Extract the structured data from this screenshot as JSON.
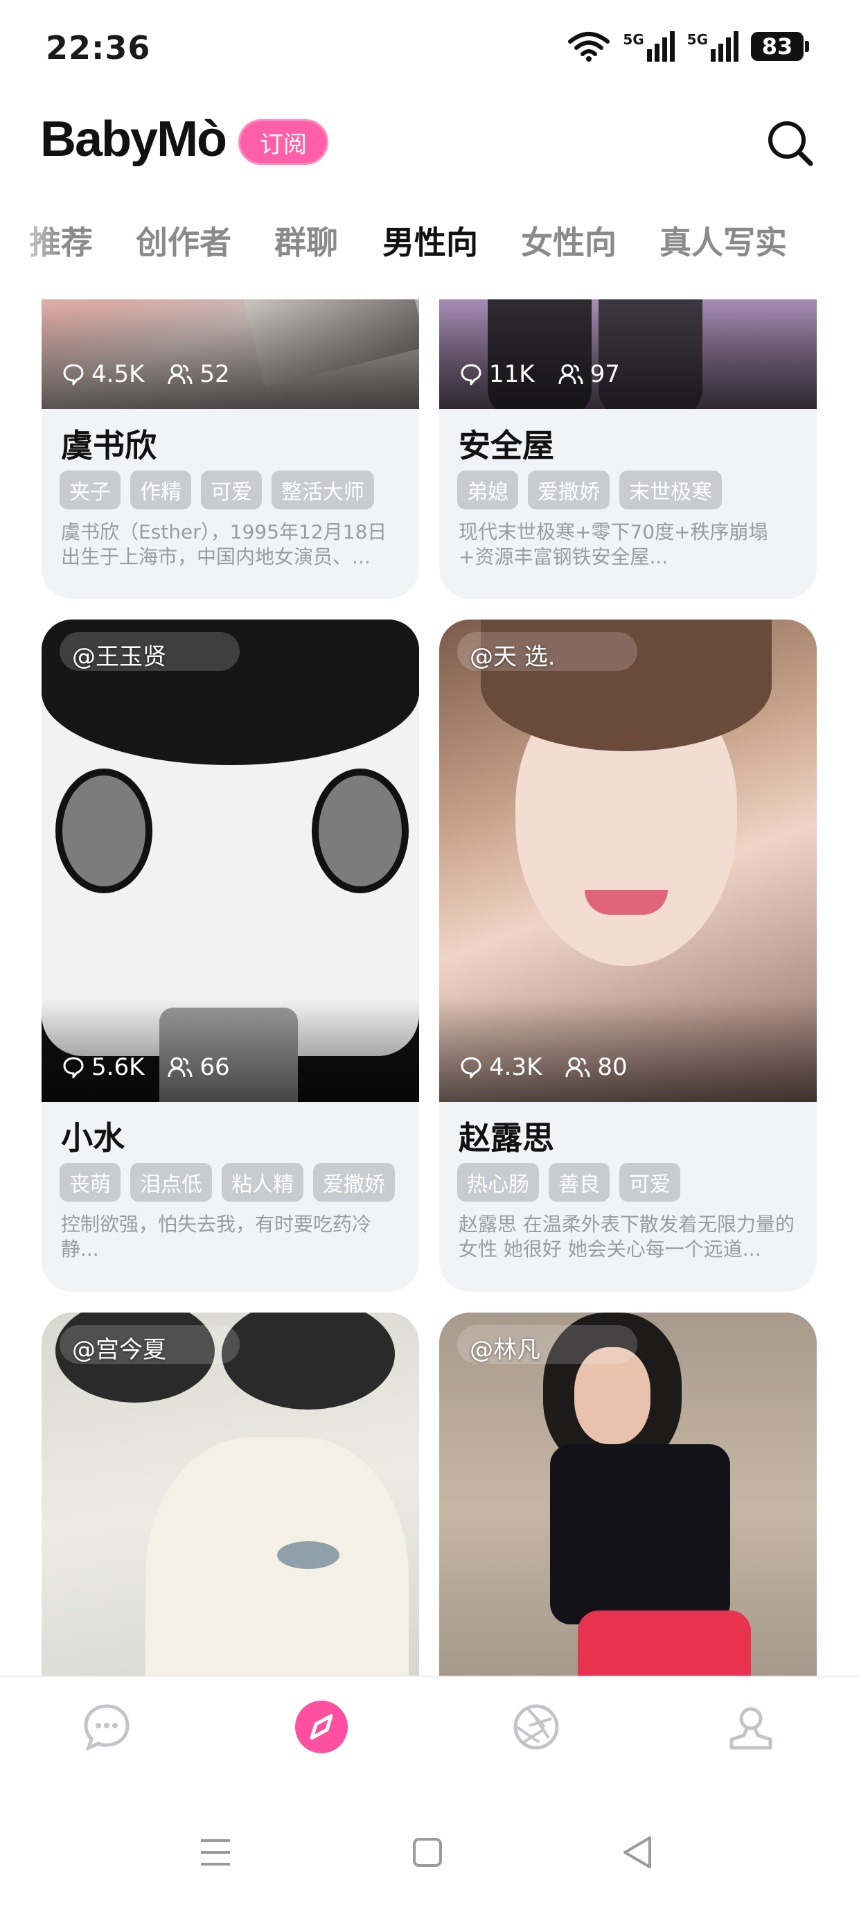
{
  "status_bar": {
    "time": "22:36",
    "battery": "83",
    "network_1": "5G",
    "network_2": "5G"
  },
  "header": {
    "logo_text": "BabyMò",
    "subscribe_label": "订阅"
  },
  "tabs": [
    "推荐",
    "创作者",
    "群聊",
    "男性向",
    "女性向",
    "真人写实"
  ],
  "active_tab": "男性向",
  "cards": [
    {
      "name": "虞书欣",
      "comments": "4.5K",
      "members": "52",
      "tags": [
        "夹子",
        "作精",
        "可爱",
        "整活大师"
      ],
      "description": "虞书欣（Esther），1995年12月18日出生于上海市，中国内地女演员、..."
    },
    {
      "name": "安全屋",
      "comments": "11K",
      "members": "97",
      "tags": [
        "弟媳",
        "爱撒娇",
        "末世极寒"
      ],
      "description": "现代末世极寒+零下70度+秩序崩塌+资源丰富钢铁安全屋..."
    },
    {
      "creator": "@王玉贤",
      "name": "小水",
      "comments": "5.6K",
      "members": "66",
      "tags": [
        "丧萌",
        "泪点低",
        "粘人精",
        "爱撒娇"
      ],
      "description": "控制欲强，怕失去我，有时要吃药冷静..."
    },
    {
      "creator": "@天 选.",
      "name": "赵露思",
      "comments": "4.3K",
      "members": "80",
      "tags": [
        "热心肠",
        "善良",
        "可爱"
      ],
      "description": "赵露思 在温柔外表下散发着无限力量的女性 她很好 她会关心每一个远道..."
    },
    {
      "creator": "@宫今夏"
    },
    {
      "creator": "@林凡"
    }
  ],
  "colors": {
    "accent": "#ff4fa0",
    "tag_bg": "#c9cbd1",
    "card_bg": "#f2f3f6"
  },
  "icons": {
    "comment": "comment-icon",
    "members": "members-icon",
    "search": "search-icon",
    "nav": [
      "chat-bubble-icon",
      "compass-icon",
      "aperture-icon",
      "profile-icon"
    ],
    "system": [
      "menu-icon",
      "home-square-icon",
      "back-triangle-icon"
    ]
  }
}
